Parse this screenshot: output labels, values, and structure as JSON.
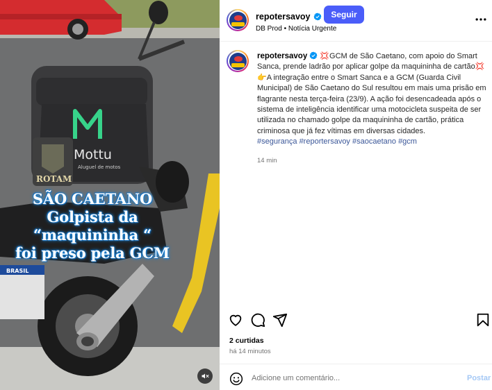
{
  "media": {
    "overlay_lines": [
      "SÃO CAETANO",
      "Golpista da",
      "“maquininha “",
      "foi preso pela GCM"
    ],
    "box_brand": "Mottu",
    "box_tagline": "Aluguel de motos",
    "rotam_label": "ROTAM",
    "plate_label": "BRASIL",
    "mute_icon": "speaker-muted-icon"
  },
  "header": {
    "username": "repotersavoy",
    "separator": "•",
    "follow_label": "Seguir",
    "subtitle": "DB Prod • Notícia Urgente"
  },
  "caption": {
    "username": "repotersavoy",
    "headline": "💢GCM de São Caetano, com apoio do Smart Sanca, prende ladrão por aplicar golpe da maquininha de cartão💢",
    "body": "👉A integração entre o Smart Sanca e a GCM (Guarda Civil Municipal) de São Caetano do Sul resultou em mais uma prisão em flagrante nesta terça-feira (23/9). A ação foi desencadeada após o sistema de inteligência identificar uma motocicleta suspeita de ser utilizada no chamado golpe da maquininha de cartão, prática criminosa que já fez vítimas em diversas cidades.",
    "hashtags": [
      "#segurança",
      "#reportersavoy",
      "#saocaetano",
      "#gcm"
    ],
    "time": "14 min"
  },
  "actions": {
    "like_icon": "heart-icon",
    "comment_icon": "comment-icon",
    "share_icon": "share-icon",
    "save_icon": "bookmark-icon"
  },
  "stats": {
    "likes": "2 curtidas",
    "ago": "há 14 minutos"
  },
  "comment": {
    "placeholder": "Adicione um comentário...",
    "post_label": "Postar"
  },
  "colors": {
    "follow_button": "#4a5df9",
    "hashtag": "#3a5698",
    "post_disabled": "#a4c8f5",
    "overlay_glow": "#1a86d8"
  }
}
